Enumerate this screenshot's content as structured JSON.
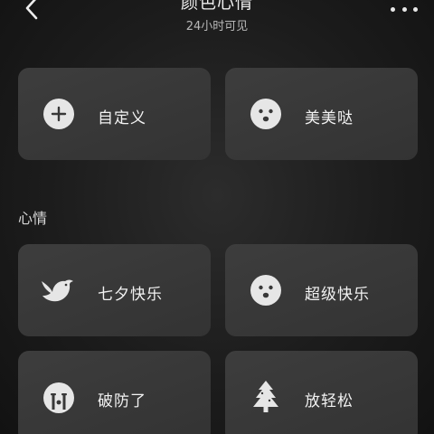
{
  "header": {
    "title": "颜色心情",
    "subtitle": "24小时可见"
  },
  "top_cards": [
    {
      "label": "自定义",
      "icon": "plus-circle-icon"
    },
    {
      "label": "美美哒",
      "icon": "happy-face-icon"
    }
  ],
  "section": {
    "title": "心情"
  },
  "mood_cards": [
    {
      "label": "七夕快乐",
      "icon": "bird-icon"
    },
    {
      "label": "超级快乐",
      "icon": "happy-face-icon"
    },
    {
      "label": "破防了",
      "icon": "crying-face-icon"
    },
    {
      "label": "放轻松",
      "icon": "tree-icon"
    }
  ],
  "colors": {
    "card": "#383838",
    "icon": "#e6e6e6",
    "text": "#f2f2f2"
  }
}
